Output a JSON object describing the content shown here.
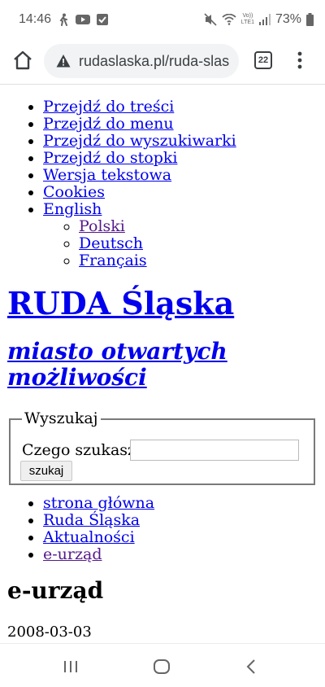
{
  "status_bar": {
    "time": "14:46",
    "battery": "73%",
    "volte_label": "Vo))",
    "lte_label": "LTE1"
  },
  "browser": {
    "url": "rudaslaska.pl/ruda-slas",
    "tab_count": "22"
  },
  "skip_links": [
    "Przejdź do treści",
    "Przejdź do menu",
    "Przejdź do wyszukiwarki",
    "Przejdź do stopki",
    "Wersja tekstowa",
    "Cookies",
    "English"
  ],
  "languages": [
    "Polski",
    "Deutsch",
    "Français"
  ],
  "site": {
    "title": "RUDA Śląska",
    "subtitle": "miasto otwartych możliwości"
  },
  "search": {
    "legend": "Wyszukaj",
    "label": "Czego szukasz?",
    "value": "",
    "button": "szukaj"
  },
  "breadcrumb": [
    "strona główna",
    "Ruda Śląska",
    "Aktualności",
    "e-urząd"
  ],
  "content": {
    "heading": "e-urząd",
    "date": "2008-03-03"
  },
  "colors": {
    "link": "#0000ee",
    "visited": "#551a8b"
  }
}
